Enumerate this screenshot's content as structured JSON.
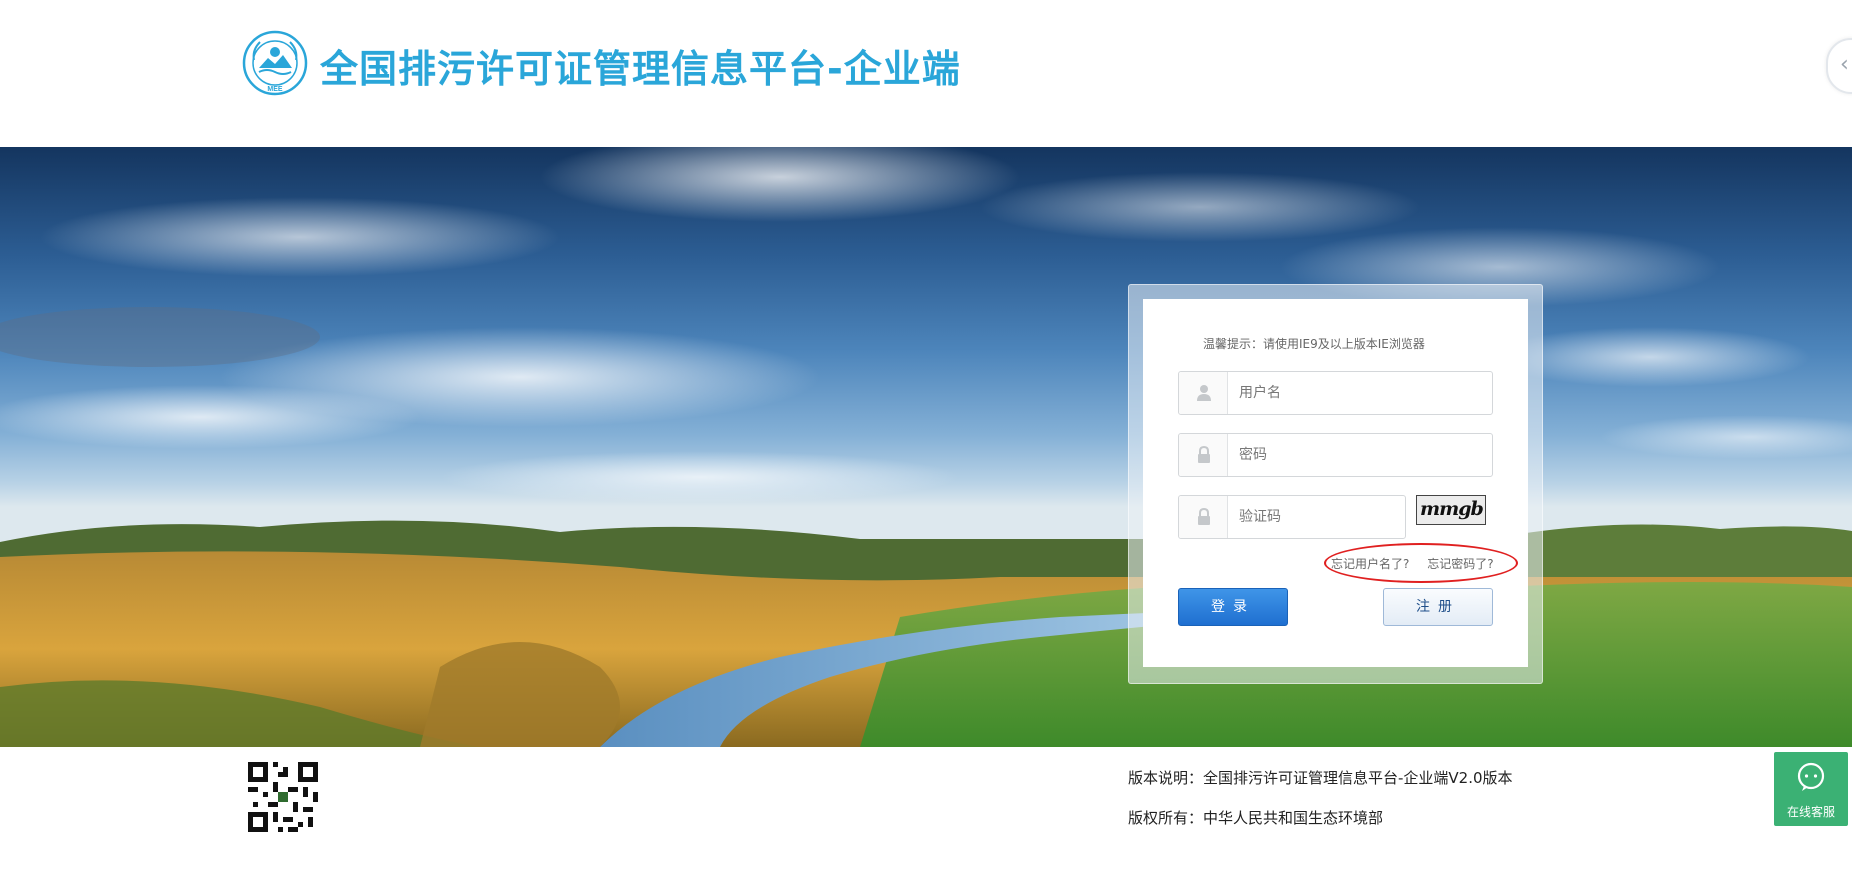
{
  "header": {
    "title": "全国排污许可证管理信息平台-企业端",
    "logo_text": "MEE"
  },
  "login": {
    "tip": "温馨提示：请使用IE9及以上版本IE浏览器",
    "username_placeholder": "用户名",
    "password_placeholder": "密码",
    "captcha_placeholder": "验证码",
    "captcha_text": "mmgb",
    "forgot_username": "忘记用户名了?",
    "forgot_password": "忘记密码了?",
    "login_button": "登录",
    "register_button": "注册"
  },
  "footer": {
    "version": "版本说明：全国排污许可证管理信息平台-企业端V2.0版本",
    "copyright": "版权所有：中华人民共和国生态环境部"
  },
  "service": {
    "label": "在线客服"
  },
  "colors": {
    "title": "#2aa6d9",
    "login_button": "#2b7fde",
    "service": "#3bb174",
    "highlight": "#e02020"
  }
}
